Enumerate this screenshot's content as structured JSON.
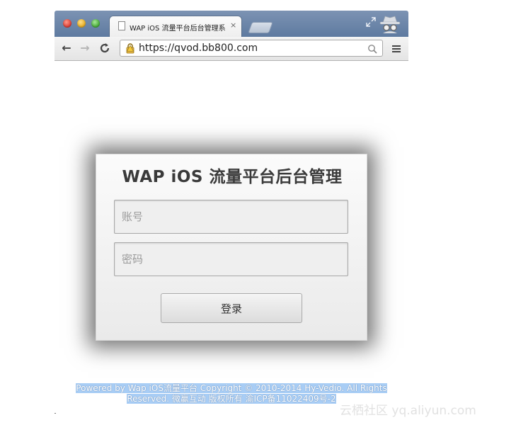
{
  "browser": {
    "tab_title": "WAP iOS 流量平台后台管理系",
    "tab_close": "×",
    "url": "https://qvod.bb800.com"
  },
  "login": {
    "title": "WAP iOS 流量平台后台管理",
    "account_placeholder": "账号",
    "password_placeholder": "密码",
    "submit_label": "登录"
  },
  "footer": {
    "line1": "Powered by Wap iOS流量平台 Copyright © 2010-2014 Hy-Vedio. All Rights",
    "line2": "Reserved. 微赢互动 版权所有 渝ICP备11022409号-2"
  },
  "watermark": {
    "text": "云栖社区 yq.aliyun.com"
  },
  "colors": {
    "titlebar": "#6a84a8",
    "footer_highlight": "#a8cdf5",
    "panel_bg": "#f2f2f2"
  }
}
